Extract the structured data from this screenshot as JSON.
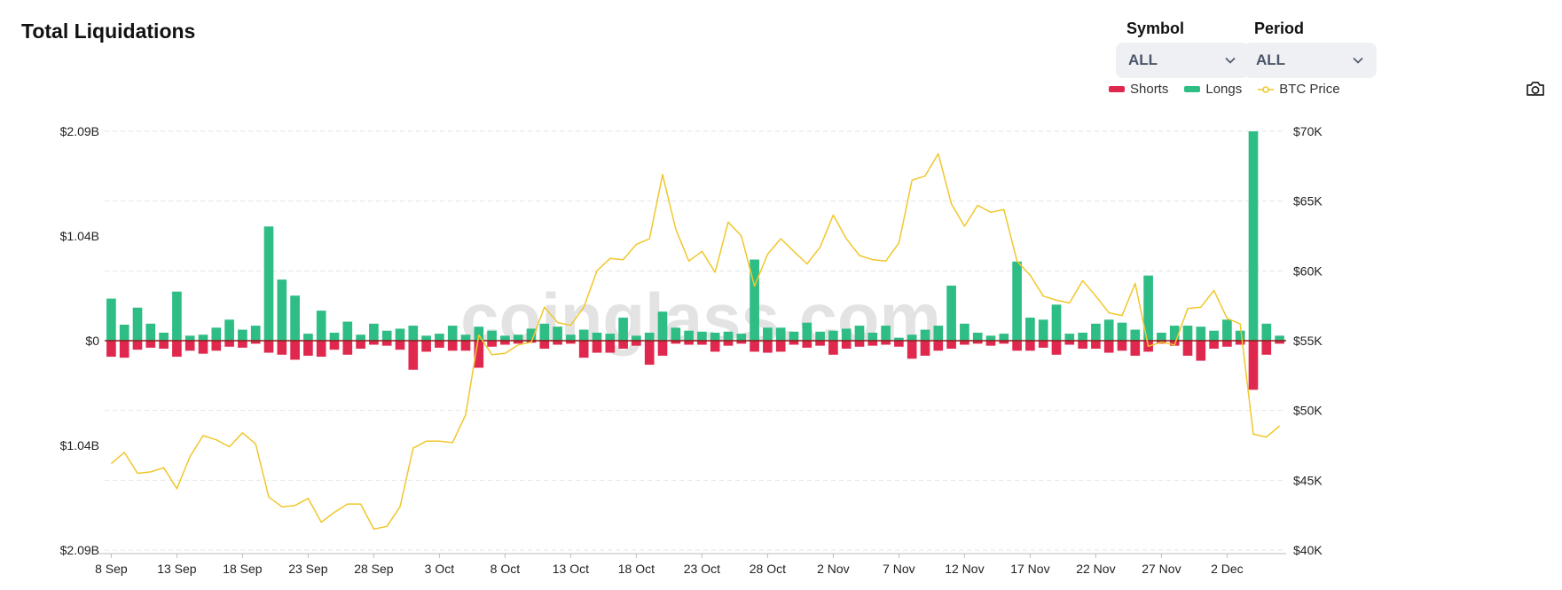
{
  "header": {
    "title": "Total Liquidations"
  },
  "controls": {
    "symbol": {
      "label": "Symbol",
      "value": "ALL"
    },
    "period": {
      "label": "Period",
      "value": "ALL"
    }
  },
  "legend": [
    {
      "name": "Shorts",
      "color": "#e0284f"
    },
    {
      "name": "Longs",
      "color": "#2ebd85"
    },
    {
      "name": "BTC Price",
      "color": "#f0c72c"
    }
  ],
  "icons": {
    "screenshot": "camera-icon",
    "dropdown": "chevron-down-icon"
  },
  "watermark": "coinglass.com",
  "colors": {
    "shorts": "#e0284f",
    "longs": "#2ebd85",
    "price": "#f0c72c",
    "zero_line": "#8b1a1a",
    "grid": "#e6e6e6"
  },
  "chart_data": {
    "type": "bar",
    "title": "Total Liquidations",
    "x_tick_labels": [
      "8 Sep",
      "13 Sep",
      "18 Sep",
      "23 Sep",
      "28 Sep",
      "3 Oct",
      "8 Oct",
      "13 Oct",
      "18 Oct",
      "23 Oct",
      "28 Oct",
      "2 Nov",
      "7 Nov",
      "12 Nov",
      "17 Nov",
      "22 Nov",
      "27 Nov",
      "2 Dec"
    ],
    "left_axis": {
      "ticks": [
        "$2.09B",
        "$1.04B",
        "$0",
        "$1.04B",
        "$2.09B"
      ],
      "range": [
        -2.09,
        2.09
      ],
      "unit": "B USD"
    },
    "right_axis": {
      "ticks": [
        "$70K",
        "$65K",
        "$60K",
        "$55K",
        "$50K",
        "$45K",
        "$40K"
      ],
      "range": [
        40,
        70
      ],
      "unit": "K USD"
    },
    "grid": true,
    "legend_position": "top-right",
    "series": [
      {
        "name": "Longs",
        "values": [
          0.42,
          0.16,
          0.33,
          0.17,
          0.08,
          0.49,
          0.05,
          0.06,
          0.13,
          0.21,
          0.11,
          0.15,
          1.14,
          0.61,
          0.45,
          0.07,
          0.3,
          0.08,
          0.19,
          0.06,
          0.17,
          0.1,
          0.12,
          0.15,
          0.05,
          0.07,
          0.15,
          0.06,
          0.14,
          0.1,
          0.05,
          0.06,
          0.12,
          0.17,
          0.14,
          0.06,
          0.11,
          0.08,
          0.07,
          0.23,
          0.05,
          0.08,
          0.29,
          0.13,
          0.1,
          0.09,
          0.08,
          0.09,
          0.07,
          0.81,
          0.13,
          0.13,
          0.09,
          0.18,
          0.09,
          0.1,
          0.12,
          0.15,
          0.08,
          0.15,
          0.03,
          0.06,
          0.11,
          0.15,
          0.55,
          0.17,
          0.08,
          0.05,
          0.07,
          0.79,
          0.23,
          0.21,
          0.36,
          0.07,
          0.08,
          0.17,
          0.21,
          0.18,
          0.11,
          0.65,
          0.08,
          0.15,
          0.15,
          0.14,
          0.1,
          0.21,
          0.1,
          2.09,
          0.17,
          0.05
        ]
      },
      {
        "name": "Shorts",
        "values": [
          -0.16,
          -0.17,
          -0.09,
          -0.07,
          -0.08,
          -0.16,
          -0.1,
          -0.13,
          -0.1,
          -0.06,
          -0.07,
          -0.03,
          -0.12,
          -0.14,
          -0.19,
          -0.15,
          -0.16,
          -0.09,
          -0.14,
          -0.08,
          -0.04,
          -0.05,
          -0.09,
          -0.29,
          -0.11,
          -0.07,
          -0.1,
          -0.1,
          -0.27,
          -0.06,
          -0.04,
          -0.03,
          -0.02,
          -0.08,
          -0.04,
          -0.03,
          -0.17,
          -0.12,
          -0.12,
          -0.08,
          -0.05,
          -0.24,
          -0.15,
          -0.03,
          -0.04,
          -0.04,
          -0.11,
          -0.05,
          -0.03,
          -0.11,
          -0.12,
          -0.11,
          -0.04,
          -0.07,
          -0.05,
          -0.14,
          -0.08,
          -0.06,
          -0.05,
          -0.04,
          -0.06,
          -0.18,
          -0.15,
          -0.1,
          -0.08,
          -0.04,
          -0.03,
          -0.05,
          -0.03,
          -0.1,
          -0.1,
          -0.07,
          -0.14,
          -0.04,
          -0.08,
          -0.08,
          -0.12,
          -0.1,
          -0.15,
          -0.11,
          -0.03,
          -0.05,
          -0.15,
          -0.2,
          -0.08,
          -0.06,
          -0.04,
          -0.49,
          -0.14,
          -0.03
        ]
      },
      {
        "name": "BTC Price",
        "values": [
          46.2,
          47.0,
          45.5,
          45.6,
          45.9,
          44.4,
          46.7,
          48.2,
          47.9,
          47.4,
          48.4,
          47.6,
          43.8,
          43.1,
          43.2,
          43.7,
          42.0,
          42.7,
          43.3,
          43.3,
          41.5,
          41.7,
          43.1,
          47.3,
          47.8,
          47.8,
          47.7,
          49.7,
          55.4,
          54.0,
          54.1,
          54.7,
          54.9,
          57.4,
          56.3,
          56.1,
          57.4,
          60.0,
          60.9,
          60.8,
          61.9,
          62.3,
          66.9,
          63.0,
          60.7,
          61.4,
          59.9,
          63.5,
          62.5,
          58.9,
          61.2,
          62.3,
          61.4,
          60.5,
          61.7,
          64.0,
          62.3,
          61.1,
          60.8,
          60.7,
          62.0,
          66.5,
          66.8,
          68.4,
          64.8,
          63.2,
          64.7,
          64.2,
          64.4,
          60.7,
          59.7,
          58.2,
          57.9,
          57.7,
          59.3,
          58.2,
          57.0,
          56.8,
          59.1,
          54.6,
          54.9,
          54.7,
          57.3,
          57.4,
          58.6,
          56.6,
          56.2,
          48.3,
          48.1,
          48.9
        ]
      }
    ]
  }
}
